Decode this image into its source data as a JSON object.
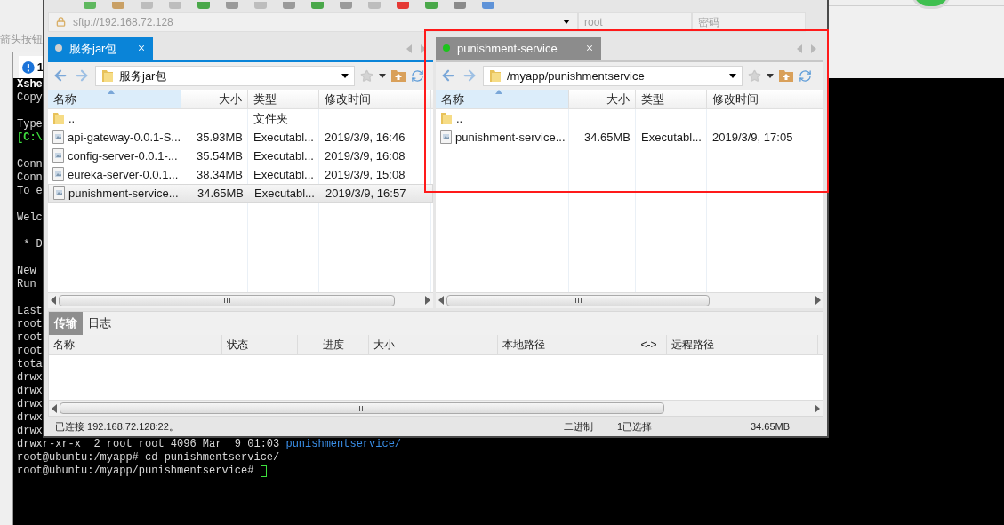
{
  "page_hint": "箭头按钮",
  "xshell": {
    "tab": {
      "label": "1"
    },
    "blocks": [
      [
        {
          "text": "Xshe",
          "kind": "bold"
        },
        {
          "text": "Copy",
          "kind": "plain"
        }
      ],
      [
        {
          "text": "Type",
          "kind": "plain"
        },
        {
          "text": "[C:\\",
          "kind": "local"
        }
      ],
      [
        {
          "text": "Conn",
          "kind": "plain"
        },
        {
          "text": "Conn",
          "kind": "plain"
        },
        {
          "text": "To e",
          "kind": "plain"
        }
      ],
      [
        {
          "text": "Welc",
          "kind": "plain"
        }
      ],
      [
        {
          "text": " * D",
          "kind": "plain"
        }
      ],
      [
        {
          "text": "New",
          "kind": "plain"
        },
        {
          "text": "Run",
          "kind": "plain"
        }
      ],
      [
        {
          "text": "Last",
          "kind": "plain"
        },
        {
          "text": "root",
          "kind": "plain"
        },
        {
          "text": "root",
          "kind": "plain"
        },
        {
          "text": "root",
          "kind": "plain"
        },
        {
          "text": "tota",
          "kind": "plain"
        },
        {
          "text": "drwx",
          "kind": "plain"
        },
        {
          "text": "drwx",
          "kind": "plain"
        },
        {
          "text": "drwx",
          "kind": "plain"
        },
        {
          "text": "drwx",
          "kind": "plain"
        },
        {
          "text": "drwx",
          "kind": "plain"
        }
      ]
    ],
    "listing_line": {
      "text": "drwxr-xr-x  2 root root 4096 Mar  9 01:03 ",
      "directory": "punishmentservice/"
    },
    "command_line": "root@ubuntu:/myapp# cd punishmentservice/",
    "prompt": "root@ubuntu:/myapp/punishmentservice# "
  },
  "xftp": {
    "address": "sftp://192.168.72.128",
    "user": "root",
    "password_placeholder": "密码",
    "panes": [
      {
        "tab": {
          "label": "服务jar包",
          "selected": true,
          "color": "#d0d0d0"
        },
        "path": "服务jar包",
        "columns": [
          "名称",
          "大小",
          "类型",
          "修改时间"
        ],
        "rows": [
          {
            "kind": "folder",
            "name": "..",
            "type": "文件夹",
            "selected": false
          },
          {
            "kind": "file",
            "name": "api-gateway-0.0.1-S...",
            "size": "35.93MB",
            "type": "Executabl...",
            "modified": "2019/3/9, 16:46",
            "selected": false
          },
          {
            "kind": "file",
            "name": "config-server-0.0.1-...",
            "size": "35.54MB",
            "type": "Executabl...",
            "modified": "2019/3/9, 16:08",
            "selected": false
          },
          {
            "kind": "file",
            "name": "eureka-server-0.0.1...",
            "size": "38.34MB",
            "type": "Executabl...",
            "modified": "2019/3/9, 15:08",
            "selected": false
          },
          {
            "kind": "file",
            "name": "punishment-service...",
            "size": "34.65MB",
            "type": "Executabl...",
            "modified": "2019/3/9, 16:57",
            "selected": true
          }
        ]
      },
      {
        "tab": {
          "label": "punishment-service",
          "selected": false,
          "color": "#1cc41c"
        },
        "path": "/myapp/punishmentservice",
        "columns": [
          "名称",
          "大小",
          "类型",
          "修改时间"
        ],
        "rows": [
          {
            "kind": "folder",
            "name": "..",
            "selected": false
          },
          {
            "kind": "file",
            "name": "punishment-service...",
            "size": "34.65MB",
            "type": "Executabl...",
            "modified": "2019/3/9, 17:05",
            "selected": false
          }
        ]
      }
    ],
    "transfer": {
      "tabs": [
        {
          "label": "传输",
          "selected": true
        },
        {
          "label": "日志",
          "selected": false
        }
      ],
      "columns": [
        "名称",
        "状态",
        "进度",
        "大小",
        "本地路径",
        "<->",
        "远程路径"
      ]
    },
    "status_bar": {
      "connection": "已连接 192.168.72.128:22。",
      "mode": "二进制",
      "selection": "1已选择",
      "size": "34.65MB"
    }
  },
  "annotation": {
    "kind": "rectangle",
    "color": "#ff1a1a"
  }
}
